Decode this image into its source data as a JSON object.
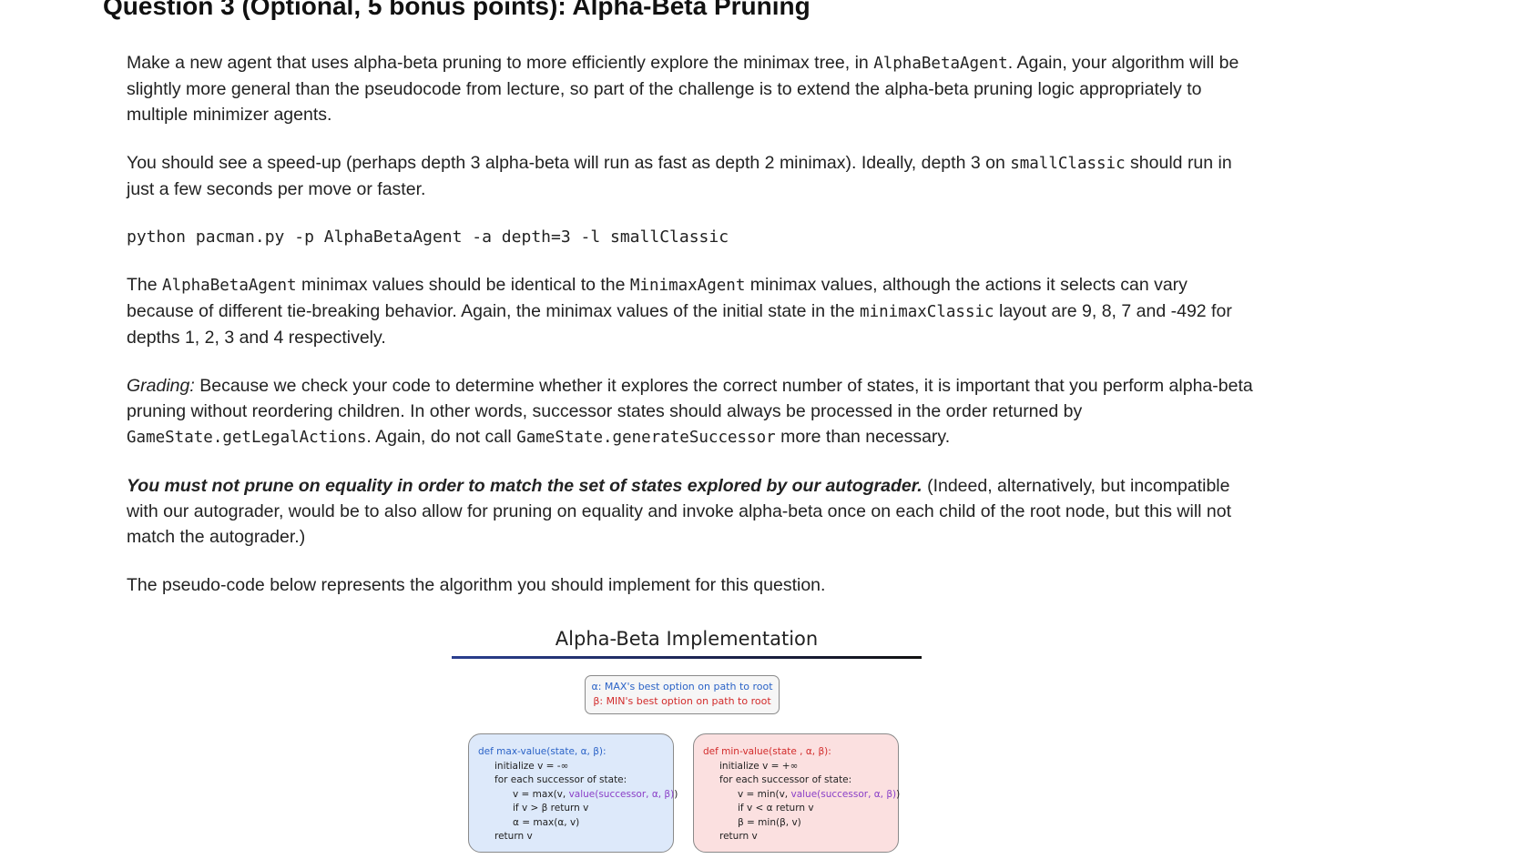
{
  "heading": "Question 3 (Optional, 5 bonus points): Alpha-Beta Pruning",
  "p1": {
    "t1": "Make a new agent that uses alpha-beta pruning to more efficiently explore the minimax tree, in ",
    "c1": "AlphaBetaAgent",
    "t2": ". Again, your algorithm will be slightly more general than the pseudocode from lecture, so part of the challenge is to extend the alpha-beta pruning logic appropriately to multiple minimizer agents."
  },
  "p2": {
    "t1": "You should see a speed-up (perhaps depth 3 alpha-beta will run as fast as depth 2 minimax). Ideally, depth 3 on ",
    "c1": "smallClassic",
    "t2": " should run in just a few seconds per move or faster."
  },
  "command": "python pacman.py -p AlphaBetaAgent -a depth=3 -l smallClassic",
  "p3": {
    "t1": "The ",
    "c1": "AlphaBetaAgent",
    "t2": " minimax values should be identical to the ",
    "c2": "MinimaxAgent",
    "t3": " minimax values, although the actions it selects can vary because of different tie-breaking behavior. Again, the minimax values of the initial state in the ",
    "c3": "minimaxClassic",
    "t4": " layout are 9, 8, 7 and -492 for depths 1, 2, 3 and 4 respectively."
  },
  "p4": {
    "label": "Grading:",
    "t1": " Because we check your code to determine whether it explores the correct number of states, it is important that you perform alpha-beta pruning without reordering children. In other words, successor states should always be processed in the order returned by ",
    "c1": "GameState.getLegalActions",
    "t2": ". Again, do not call ",
    "c2": "GameState.generateSuccessor",
    "t3": " more than necessary."
  },
  "p5": {
    "strong": "You must not prune on equality in order to match the set of states explored by our autograder.",
    "t1": " (Indeed, alternatively, but incompatible with our autograder, would be to also allow for pruning on equality and invoke alpha-beta once on each child of the root node, but this will not match the autograder.)"
  },
  "p6": "The pseudo-code below represents the algorithm you should implement for this question.",
  "figure": {
    "title": "Alpha-Beta Implementation",
    "legend_alpha": "α: MAX's best option on path to root",
    "legend_beta": "β: MIN's best option on path to root",
    "max_fn": {
      "def": "def max-value(state, α, β):",
      "l1": "initialize v = -∞",
      "l2": "for each successor of state:",
      "l3a": "v = max(v, ",
      "l3b": "value(successor, α, β)",
      "l3c": ")",
      "l4": "if v > β return v",
      "l5": "α = max(α, v)",
      "l6": "return v"
    },
    "min_fn": {
      "def": "def min-value(state , α, β):",
      "l1": "initialize v = +∞",
      "l2": "for each successor of state:",
      "l3a": "v = min(v, ",
      "l3b": "value(successor, α, β)",
      "l3c": ")",
      "l4": "if v < α return v",
      "l5": "β = min(β, v)",
      "l6": "return v"
    },
    "colors": {
      "max_bg": "#dde9fa",
      "min_bg": "#fbe0e0",
      "alpha": "#2b63c7",
      "beta": "#d22b2b",
      "call": "#8a3fc7"
    }
  }
}
